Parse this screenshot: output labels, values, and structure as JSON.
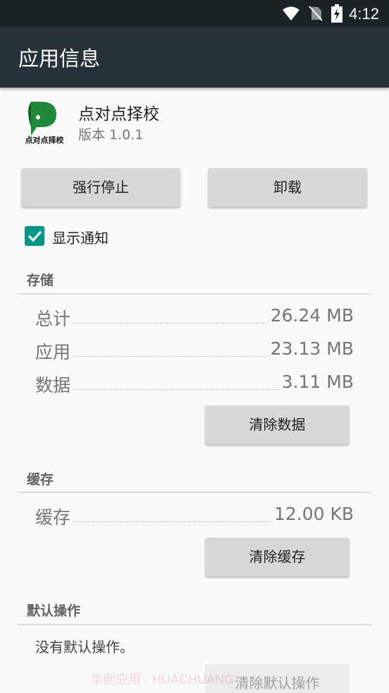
{
  "status_bar": {
    "time": "4:12"
  },
  "app_bar": {
    "title": "应用信息"
  },
  "app": {
    "logo_text": "点对点择校",
    "name": "点对点择校",
    "version": "版本 1.0.1"
  },
  "actions": {
    "force_stop": "强行停止",
    "uninstall": "卸载"
  },
  "notifications": {
    "label": "显示通知",
    "checked": true
  },
  "storage": {
    "header": "存储",
    "rows": [
      {
        "label": "总计",
        "value": "26.24 MB"
      },
      {
        "label": "应用",
        "value": "23.13 MB"
      },
      {
        "label": "数据",
        "value": "3.11 MB"
      }
    ],
    "clear_button": "清除数据"
  },
  "cache": {
    "header": "缓存",
    "row": {
      "label": "缓存",
      "value": "12.00 KB"
    },
    "clear_button": "清除缓存"
  },
  "defaults": {
    "header": "默认操作",
    "text": "没有默认操作。",
    "clear_button": "清除默认操作"
  },
  "watermark": "华创应用 · HUACHUANG",
  "colors": {
    "accent": "#009688",
    "app_bar": "#263238",
    "status_bar": "#1c2326"
  }
}
